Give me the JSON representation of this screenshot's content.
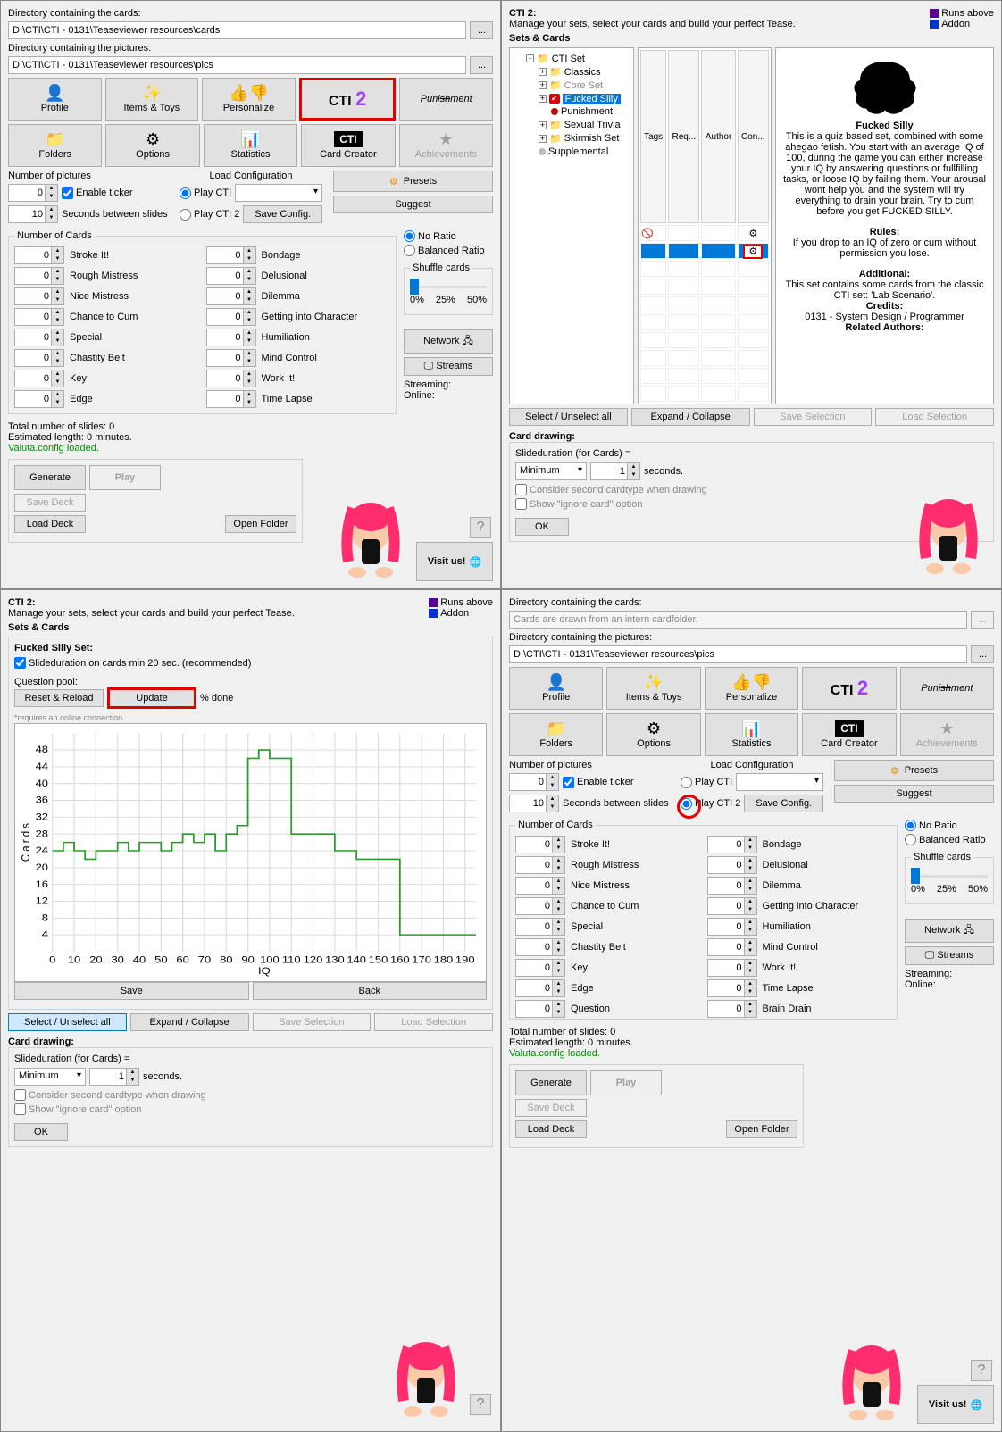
{
  "labels": {
    "dir_cards": "Directory containing the cards:",
    "dir_pics": "Directory containing the pictures:",
    "num_pics": "Number of pictures",
    "enable_ticker": "Enable ticker",
    "secs_between": "Seconds between slides",
    "load_config": "Load Configuration",
    "save_config": "Save Config.",
    "presets": "Presets",
    "suggest": "Suggest",
    "no_ratio": "No Ratio",
    "balanced_ratio": "Balanced Ratio",
    "shuffle_cards": "Shuffle cards",
    "number_of_cards": "Number of Cards",
    "total_slides": "Total number of slides: 0",
    "est_len": "Estimated length: 0 minutes.",
    "valuta": "Valuta.config loaded.",
    "generate": "Generate",
    "play": "Play",
    "save_deck": "Save Deck",
    "load_deck": "Load Deck",
    "open_folder": "Open Folder",
    "network": "Network",
    "streams": "Streams",
    "streaming": "Streaming:",
    "online": "Online:",
    "visit": "Visit us!",
    "cti2_title": "CTI 2:",
    "cti2_sub": "Manage your sets, select your cards and build your perfect Tease.",
    "runs_above": "Runs above",
    "addon": "Addon",
    "sets_cards": "Sets & Cards",
    "sel_unsel": "Select / Unselect all",
    "exp_col": "Expand / Collapse",
    "save_sel": "Save Selection",
    "load_sel": "Load Selection",
    "card_drawing": "Card drawing:",
    "slidedur": "Slideduration (for Cards) =",
    "seconds": "seconds.",
    "minimum": "Minimum",
    "consider": "Consider second cardtype when drawing",
    "show_ignore": "Show \"ignore card\" option",
    "ok": "OK",
    "play_cti": "Play CTI",
    "play_cti2": "Play CTI 2",
    "fs_set": "Fucked Silly Set:",
    "slidedur_rec": "Slideduration on cards min 20 sec. (recommended)",
    "qpool": "Question pool:",
    "reset_reload": "Reset & Reload",
    "update": "Update",
    "pct_done": "% done",
    "requires": "*requires an online connection.",
    "save": "Save",
    "back": "Back",
    "iq": "IQ",
    "cards_y": "Cards",
    "p0": "0%",
    "p25": "25%",
    "p50": "50%",
    "zero": "0",
    "ten": "10",
    "one": "1",
    "ellipsis": "...",
    "noicon": "🚫",
    "gearicon": "⚙"
  },
  "paths": {
    "cards": "D:\\CTI\\CTI - 0131\\Teaseviewer resources\\cards",
    "cards_intern": "Cards are drawn from an intern cardfolder.",
    "pics": "D:\\CTI\\CTI - 0131\\Teaseviewer resources\\pics"
  },
  "mainbtns": [
    {
      "label": "Profile",
      "name": "profile-button"
    },
    {
      "label": "Items & Toys",
      "name": "items-toys-button"
    },
    {
      "label": "Personalize",
      "name": "personalize-button"
    },
    {
      "label": "CTI 2",
      "name": "cti2-button",
      "sel": true
    },
    {
      "label": "Punishment",
      "name": "punishment-button"
    },
    {
      "label": "Folders",
      "name": "folders-button"
    },
    {
      "label": "Options",
      "name": "options-button"
    },
    {
      "label": "Statistics",
      "name": "statistics-button"
    },
    {
      "label": "Card Creator",
      "name": "card-creator-button"
    },
    {
      "label": "Achievements",
      "name": "achievements-button",
      "dis": true
    }
  ],
  "cardtypes": {
    "left": [
      "Stroke It!",
      "Rough Mistress",
      "Nice Mistress",
      "Chance to Cum",
      "Special",
      "Chastity Belt",
      "Key",
      "Edge"
    ],
    "right": [
      "Bondage",
      "Delusional",
      "Dilemma",
      "Getting into Character",
      "Humiliation",
      "Mind Control",
      "Work It!",
      "Time Lapse"
    ],
    "extra_left": "Question",
    "extra_right": "Brain Drain"
  },
  "tree": [
    {
      "label": "CTI Set",
      "exp": "-"
    },
    {
      "label": "Classics",
      "exp": "+",
      "indent": 1
    },
    {
      "label": "Core Set",
      "exp": "+",
      "indent": 1,
      "grey": true
    },
    {
      "label": "Fucked Silly",
      "exp": "+",
      "indent": 1,
      "sel": true,
      "chk": true
    },
    {
      "label": "Punishment",
      "indent": 2,
      "dot": "red"
    },
    {
      "label": "Sexual Trivia",
      "exp": "+",
      "indent": 1
    },
    {
      "label": "Skirmish Set",
      "exp": "+",
      "indent": 1
    },
    {
      "label": "Supplemental",
      "indent": 1,
      "dot": "grey"
    }
  ],
  "table_headers": [
    "Tags",
    "Req...",
    "Author",
    "Con..."
  ],
  "desc": {
    "title": "Fucked Silly",
    "body": "This is a quiz based set, combined with some ahegao fetish. You start with an average IQ of 100, during the game you can either increase your IQ by answering questions or fullfilling tasks, or loose IQ by failing them. Your arousal wont help you and the system will try everything to drain your brain. Try to cum before you get FUCKED SILLY.",
    "rules_h": "Rules:",
    "rules": "If you drop to an IQ of zero or cum without permission you lose.",
    "add_h": "Additional:",
    "add": "This set contains some cards from the classic CTI set: 'Lab Scenario'.",
    "credits_h": "Credits:",
    "credits": "0131 - System Design / Programmer",
    "related_h": "Related Authors:"
  },
  "chart_data": {
    "type": "line",
    "title": "",
    "xlabel": "IQ",
    "ylabel": "Cards",
    "x_ticks": [
      0,
      10,
      20,
      30,
      40,
      50,
      60,
      70,
      80,
      90,
      100,
      110,
      120,
      130,
      140,
      150,
      160,
      170,
      180,
      190
    ],
    "y_ticks": [
      4,
      8,
      12,
      16,
      20,
      24,
      28,
      32,
      36,
      40,
      44,
      48
    ],
    "xlim": [
      0,
      195
    ],
    "ylim": [
      0,
      52
    ],
    "series": [
      {
        "name": "cards",
        "color": "#2b9a2b",
        "x": [
          0,
          5,
          10,
          15,
          20,
          25,
          30,
          35,
          40,
          45,
          50,
          55,
          60,
          65,
          70,
          75,
          80,
          85,
          90,
          95,
          100,
          105,
          110,
          115,
          120,
          125,
          130,
          135,
          140,
          145,
          150,
          155,
          160,
          165,
          170,
          175,
          180,
          185,
          190,
          195
        ],
        "y": [
          24,
          26,
          24,
          22,
          24,
          24,
          26,
          24,
          26,
          26,
          24,
          26,
          28,
          26,
          28,
          24,
          28,
          30,
          46,
          48,
          46,
          46,
          28,
          28,
          28,
          28,
          24,
          24,
          22,
          22,
          22,
          22,
          4,
          4,
          4,
          4,
          4,
          4,
          4,
          4
        ]
      }
    ]
  },
  "colors": {
    "purple": "#5a0099",
    "blue": "#0033cc",
    "red_hl": "#e30000",
    "green_line": "#2b9a2b"
  }
}
